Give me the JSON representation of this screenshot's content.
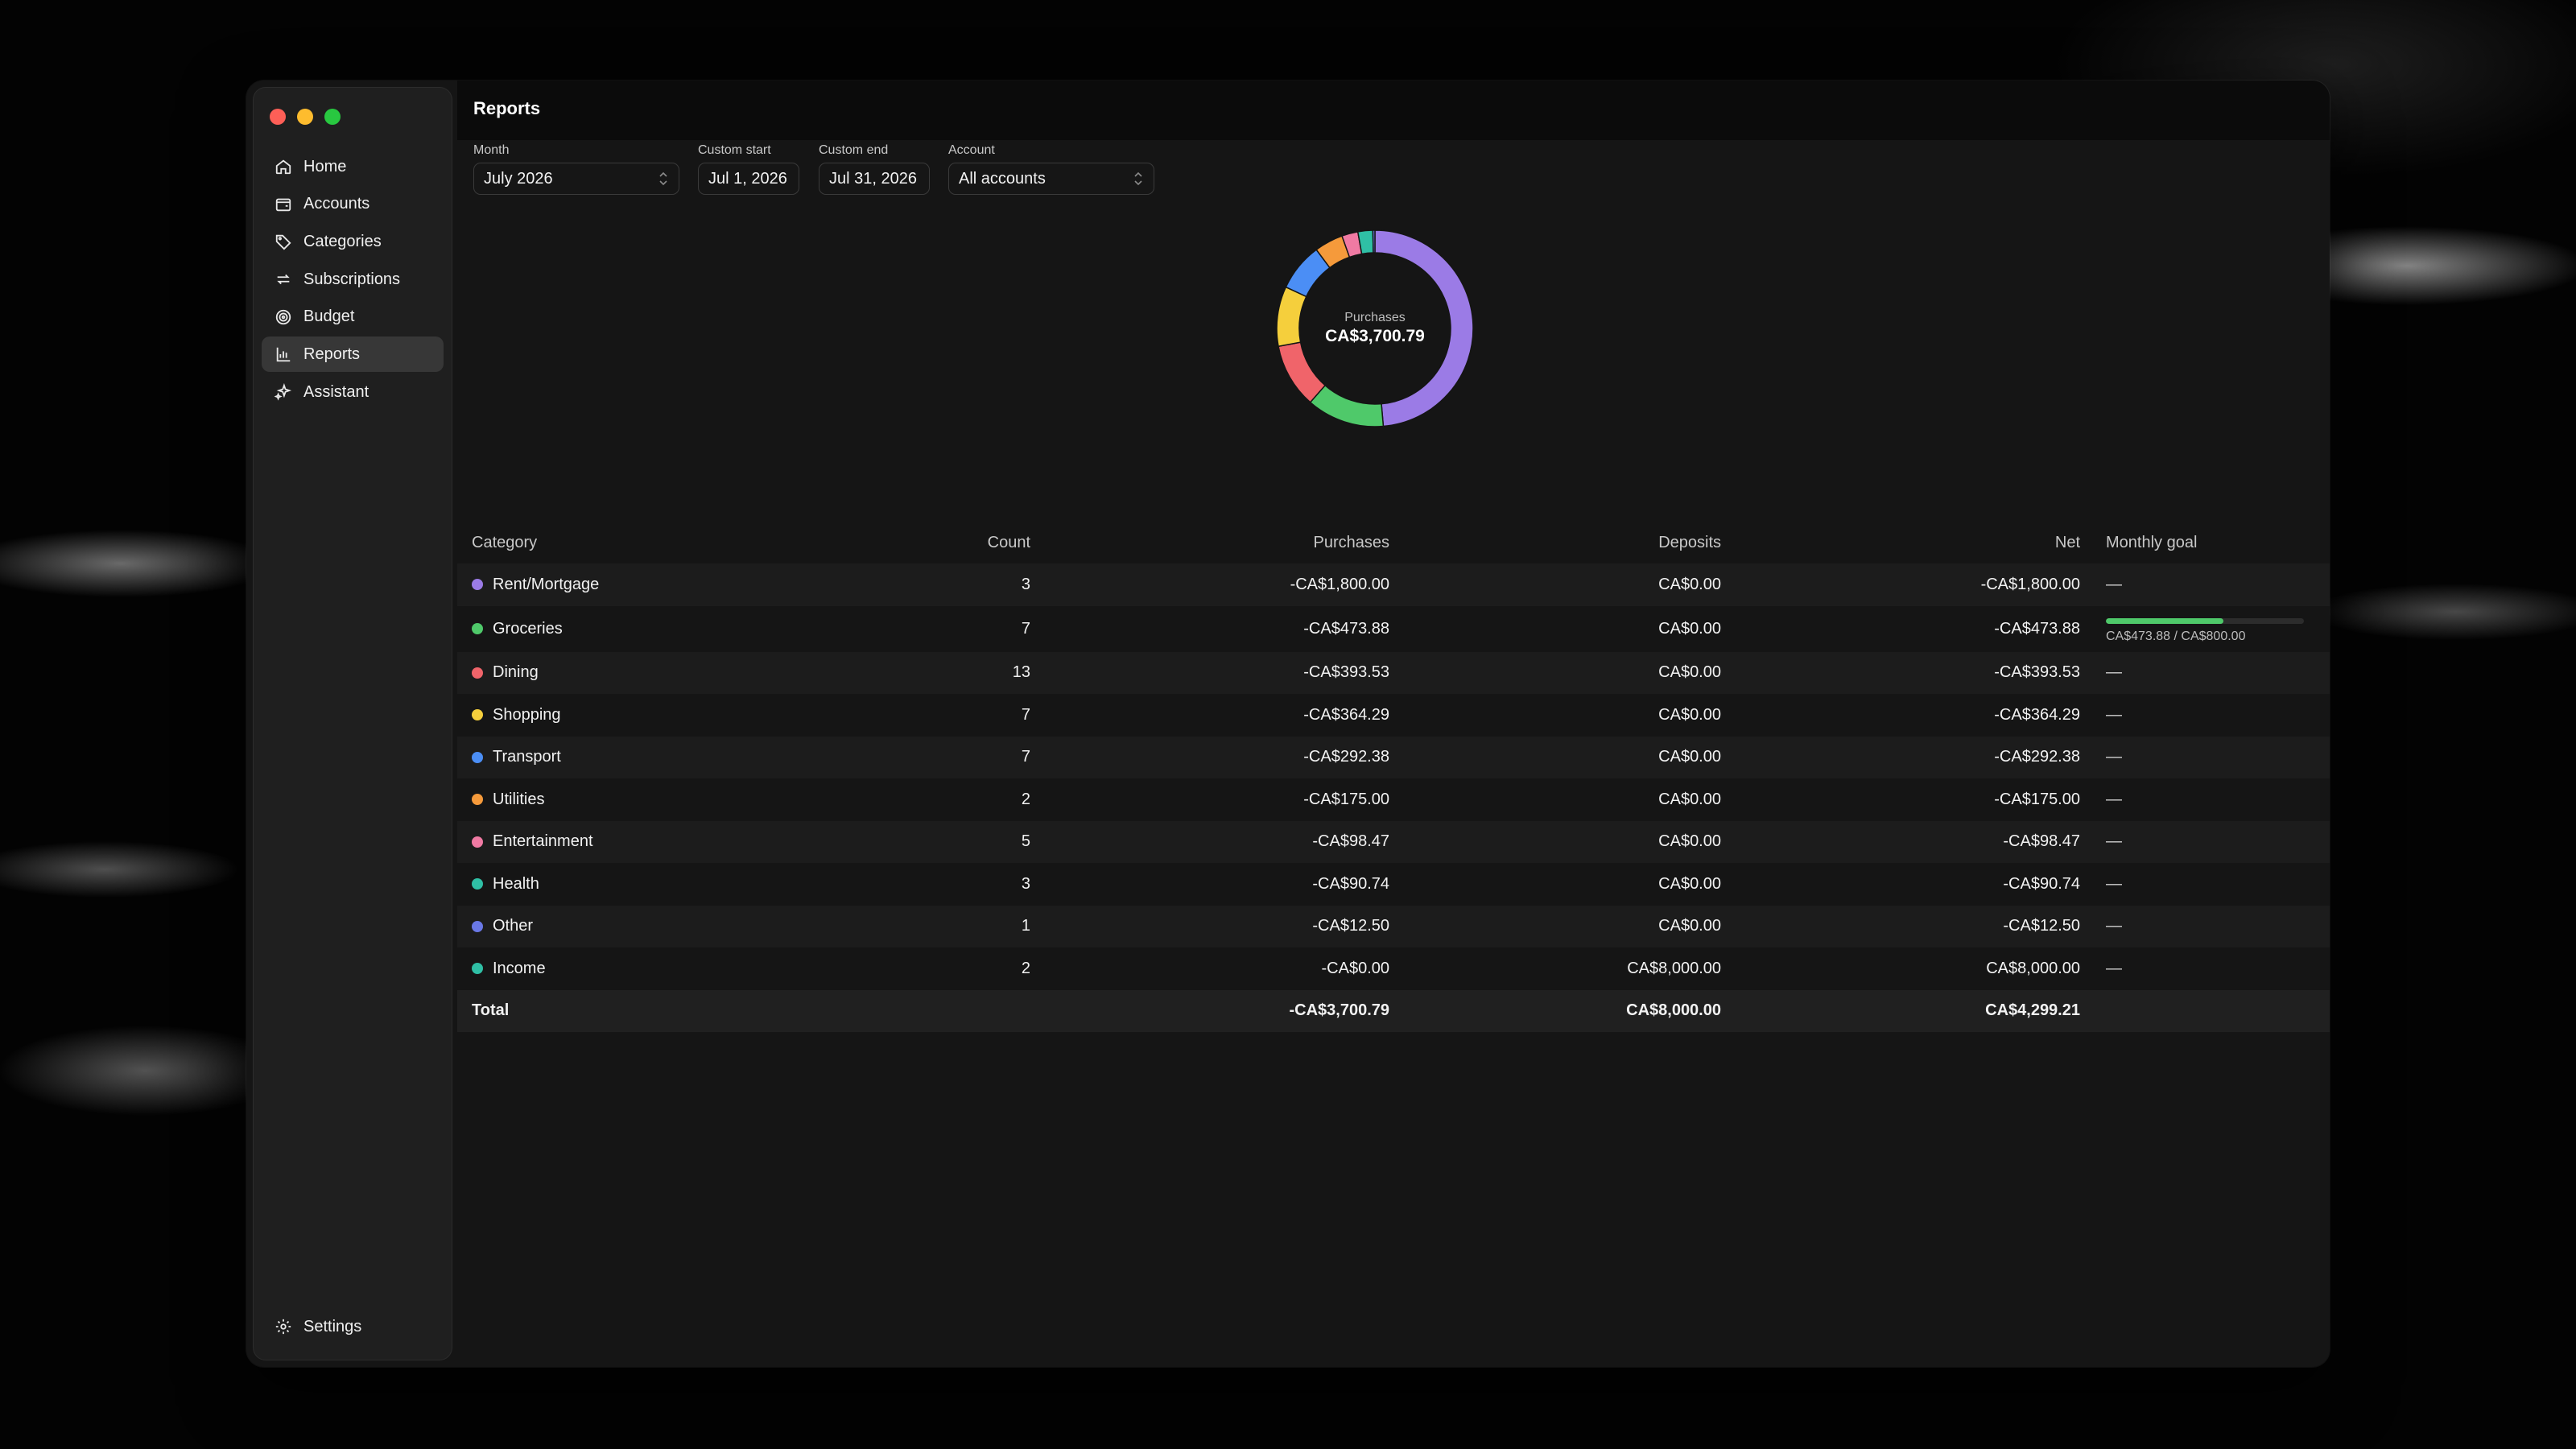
{
  "sidebar": {
    "items": [
      {
        "label": "Home",
        "icon": "home-icon"
      },
      {
        "label": "Accounts",
        "icon": "wallet-icon"
      },
      {
        "label": "Categories",
        "icon": "tag-icon"
      },
      {
        "label": "Subscriptions",
        "icon": "repeat-icon"
      },
      {
        "label": "Budget",
        "icon": "target-icon"
      },
      {
        "label": "Reports",
        "icon": "bar-chart-icon",
        "active": true
      },
      {
        "label": "Assistant",
        "icon": "sparkle-icon"
      }
    ],
    "settings_label": "Settings"
  },
  "header": {
    "title": "Reports"
  },
  "filters": {
    "month": {
      "label": "Month",
      "value": "July 2026"
    },
    "custom_start": {
      "label": "Custom start",
      "value": "Jul 1, 2026"
    },
    "custom_end": {
      "label": "Custom end",
      "value": "Jul 31, 2026"
    },
    "account": {
      "label": "Account",
      "value": "All accounts"
    }
  },
  "donut": {
    "label": "Purchases",
    "value": "CA$3,700.79"
  },
  "table": {
    "headers": {
      "category": "Category",
      "count": "Count",
      "purchases": "Purchases",
      "deposits": "Deposits",
      "net": "Net",
      "goal": "Monthly goal"
    },
    "rows": [
      {
        "category": "Rent/Mortgage",
        "color": "#9b7be6",
        "count": "3",
        "purchases": "-CA$1,800.00",
        "deposits": "CA$0.00",
        "net": "-CA$1,800.00",
        "goal": "—"
      },
      {
        "category": "Groceries",
        "color": "#4fc96a",
        "count": "7",
        "purchases": "-CA$473.88",
        "deposits": "CA$0.00",
        "net": "-CA$473.88",
        "goal": "CA$473.88 / CA$800.00",
        "goal_progress": 0.592
      },
      {
        "category": "Dining",
        "color": "#f0646a",
        "count": "13",
        "purchases": "-CA$393.53",
        "deposits": "CA$0.00",
        "net": "-CA$393.53",
        "goal": "—"
      },
      {
        "category": "Shopping",
        "color": "#f5cf3c",
        "count": "7",
        "purchases": "-CA$364.29",
        "deposits": "CA$0.00",
        "net": "-CA$364.29",
        "goal": "—"
      },
      {
        "category": "Transport",
        "color": "#4b8ef5",
        "count": "7",
        "purchases": "-CA$292.38",
        "deposits": "CA$0.00",
        "net": "-CA$292.38",
        "goal": "—"
      },
      {
        "category": "Utilities",
        "color": "#f59a3b",
        "count": "2",
        "purchases": "-CA$175.00",
        "deposits": "CA$0.00",
        "net": "-CA$175.00",
        "goal": "—"
      },
      {
        "category": "Entertainment",
        "color": "#f07aa3",
        "count": "5",
        "purchases": "-CA$98.47",
        "deposits": "CA$0.00",
        "net": "-CA$98.47",
        "goal": "—"
      },
      {
        "category": "Health",
        "color": "#2fbfa5",
        "count": "3",
        "purchases": "-CA$90.74",
        "deposits": "CA$0.00",
        "net": "-CA$90.74",
        "goal": "—"
      },
      {
        "category": "Other",
        "color": "#6a78e6",
        "count": "1",
        "purchases": "-CA$12.50",
        "deposits": "CA$0.00",
        "net": "-CA$12.50",
        "goal": "—"
      },
      {
        "category": "Income",
        "color": "#2fbfa5",
        "count": "2",
        "purchases": "-CA$0.00",
        "deposits": "CA$8,000.00",
        "net": "CA$8,000.00",
        "goal": "—"
      }
    ],
    "total": {
      "label": "Total",
      "purchases": "-CA$3,700.79",
      "deposits": "CA$8,000.00",
      "net": "CA$4,299.21"
    }
  },
  "chart_data": {
    "type": "pie",
    "title": "Purchases",
    "categories": [
      "Rent/Mortgage",
      "Groceries",
      "Dining",
      "Shopping",
      "Transport",
      "Utilities",
      "Entertainment",
      "Health",
      "Other"
    ],
    "values": [
      1800.0,
      473.88,
      393.53,
      364.29,
      292.38,
      175.0,
      98.47,
      90.74,
      12.5
    ],
    "colors": [
      "#9b7be6",
      "#4fc96a",
      "#f0646a",
      "#f5cf3c",
      "#4b8ef5",
      "#f59a3b",
      "#f07aa3",
      "#2fbfa5",
      "#6a78e6"
    ]
  }
}
